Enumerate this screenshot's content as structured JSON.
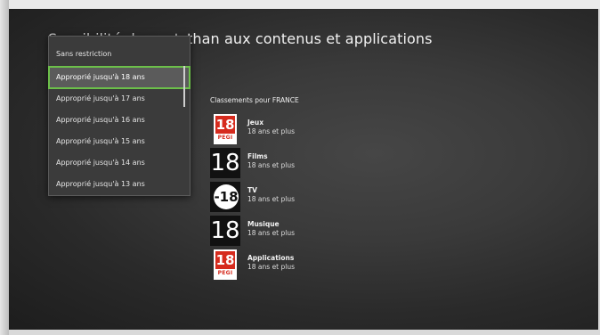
{
  "page": {
    "title_obscured": "Sensibilité du contenu",
    "title_visible": "than aux contenus et applications"
  },
  "dropdown": {
    "scroll_label": "scroll",
    "items": [
      {
        "label": "Sans restriction",
        "selected": false
      },
      {
        "label": "Approprié jusqu'à 18 ans",
        "selected": true
      },
      {
        "label": "Approprié jusqu'à 17 ans",
        "selected": false
      },
      {
        "label": "Approprié jusqu'à 16 ans",
        "selected": false
      },
      {
        "label": "Approprié jusqu'à 15 ans",
        "selected": false
      },
      {
        "label": "Approprié jusqu'à 14 ans",
        "selected": false
      },
      {
        "label": "Approprié jusqu'à 13 ans",
        "selected": false
      }
    ]
  },
  "ratings": {
    "header": "Classements pour FRANCE",
    "items": [
      {
        "name": "Jeux",
        "desc": "18 ans et plus",
        "badge_type": "pegi",
        "badge_value": "18",
        "badge_label": "PEGI",
        "icon": "pegi-18-icon"
      },
      {
        "name": "Films",
        "desc": "18 ans et plus",
        "badge_type": "plain",
        "badge_value": "18",
        "icon": "film-18-icon"
      },
      {
        "name": "TV",
        "desc": "18 ans et plus",
        "badge_type": "tv",
        "badge_value": "-18",
        "icon": "tv-minus18-icon"
      },
      {
        "name": "Musique",
        "desc": "18 ans et plus",
        "badge_type": "plain",
        "badge_value": "18",
        "icon": "music-18-icon"
      },
      {
        "name": "Applications",
        "desc": "18 ans et plus",
        "badge_type": "pegi",
        "badge_value": "18",
        "badge_label": "PEGI",
        "icon": "pegi-18-icon"
      }
    ]
  },
  "colors": {
    "selection_outline": "#6cc04a",
    "pegi_red": "#d62b1e"
  }
}
